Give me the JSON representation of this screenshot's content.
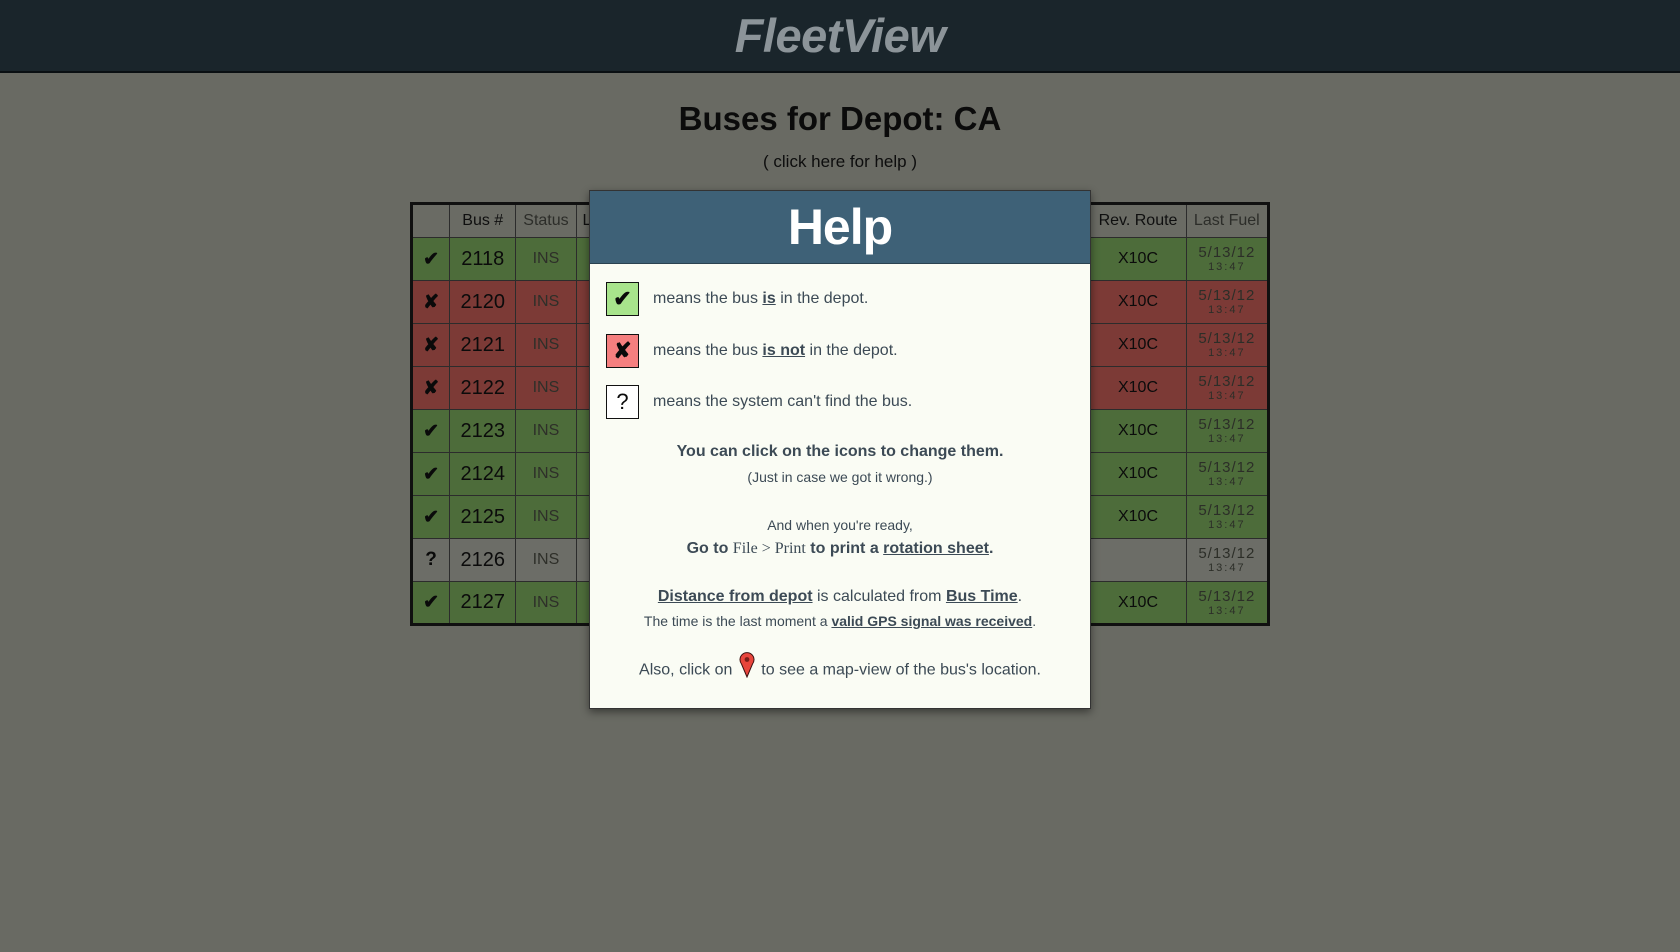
{
  "app": {
    "logo": "FleetView"
  },
  "page": {
    "title": "Buses for Depot: CA",
    "help_link": "( click here for help )"
  },
  "table": {
    "headers": {
      "bus": "Bus #",
      "status": "Status",
      "partial": "L",
      "route": "Rev. Route",
      "fuel": "Last Fuel"
    },
    "rows": [
      {
        "state": "in",
        "icon": "✔",
        "bus": "2118",
        "status": "INS",
        "route": "X10C",
        "fuel_date": "5/13/12",
        "fuel_time": "13:47"
      },
      {
        "state": "out",
        "icon": "✘",
        "bus": "2120",
        "status": "INS",
        "route": "X10C",
        "fuel_date": "5/13/12",
        "fuel_time": "13:47"
      },
      {
        "state": "out",
        "icon": "✘",
        "bus": "2121",
        "status": "INS",
        "route": "X10C",
        "fuel_date": "5/13/12",
        "fuel_time": "13:47"
      },
      {
        "state": "out",
        "icon": "✘",
        "bus": "2122",
        "status": "INS",
        "route": "X10C",
        "fuel_date": "5/13/12",
        "fuel_time": "13:47"
      },
      {
        "state": "in",
        "icon": "✔",
        "bus": "2123",
        "status": "INS",
        "route": "X10C",
        "fuel_date": "5/13/12",
        "fuel_time": "13:47"
      },
      {
        "state": "in",
        "icon": "✔",
        "bus": "2124",
        "status": "INS",
        "route": "X10C",
        "fuel_date": "5/13/12",
        "fuel_time": "13:47"
      },
      {
        "state": "in",
        "icon": "✔",
        "bus": "2125",
        "status": "INS",
        "route": "X10C",
        "fuel_date": "5/13/12",
        "fuel_time": "13:47"
      },
      {
        "state": "unk",
        "icon": "?",
        "bus": "2126",
        "status": "INS",
        "route": "",
        "fuel_date": "5/13/12",
        "fuel_time": "13:47"
      },
      {
        "state": "in",
        "icon": "✔",
        "bus": "2127",
        "status": "INS",
        "route": "X10C",
        "fuel_date": "5/13/12",
        "fuel_time": "13:47"
      }
    ]
  },
  "help": {
    "title": "Help",
    "legend": {
      "in_icon": "✔",
      "in_pre": "means the bus ",
      "in_em": "is",
      "in_post": " in the depot.",
      "out_icon": "✘",
      "out_pre": "means the bus ",
      "out_em": "is not",
      "out_post": " in the depot.",
      "unk_icon": "?",
      "unk_text": "means the system can't find the bus."
    },
    "click_icons": "You can click on the icons to change them.",
    "just_in_case": "(Just in case we got it wrong.)",
    "when_ready": "And when you're ready,",
    "go_to": "Go to ",
    "file_print": "File > Print",
    "to_print": " to print a ",
    "rotation_sheet": "rotation sheet",
    "period": ".",
    "distance_link": "Distance from depot",
    "calculated_from": " is calculated from ",
    "bus_time_link": "Bus Time",
    "time_is": "The time is the last moment a ",
    "gps_link": "valid GPS signal was received",
    "also_click": "Also, click on ",
    "map_view": " to see a map-view of the bus's location."
  },
  "colors": {
    "header_bg": "#1a252b",
    "modal_head": "#3e6177",
    "in_row": "#4d6c3a",
    "out_row": "#7c3a36",
    "in_box": "#a8e48c",
    "out_box": "#f57f7f"
  }
}
